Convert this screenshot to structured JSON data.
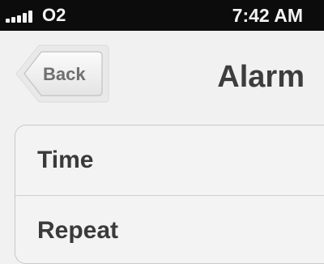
{
  "status_bar": {
    "carrier": "O2",
    "time": "7:42 AM",
    "signal_bars": 5,
    "icon": "signal-strength-icon"
  },
  "nav": {
    "back_label": "Back",
    "title": "Alarm"
  },
  "table": {
    "rows": [
      {
        "label": "Time"
      },
      {
        "label": "Repeat"
      }
    ]
  },
  "colors": {
    "status_bar_bg": "#0c0c0c",
    "page_bg": "#f1f1f1",
    "text_dark": "#3a3a3a",
    "back_text": "#6f6f6f"
  }
}
